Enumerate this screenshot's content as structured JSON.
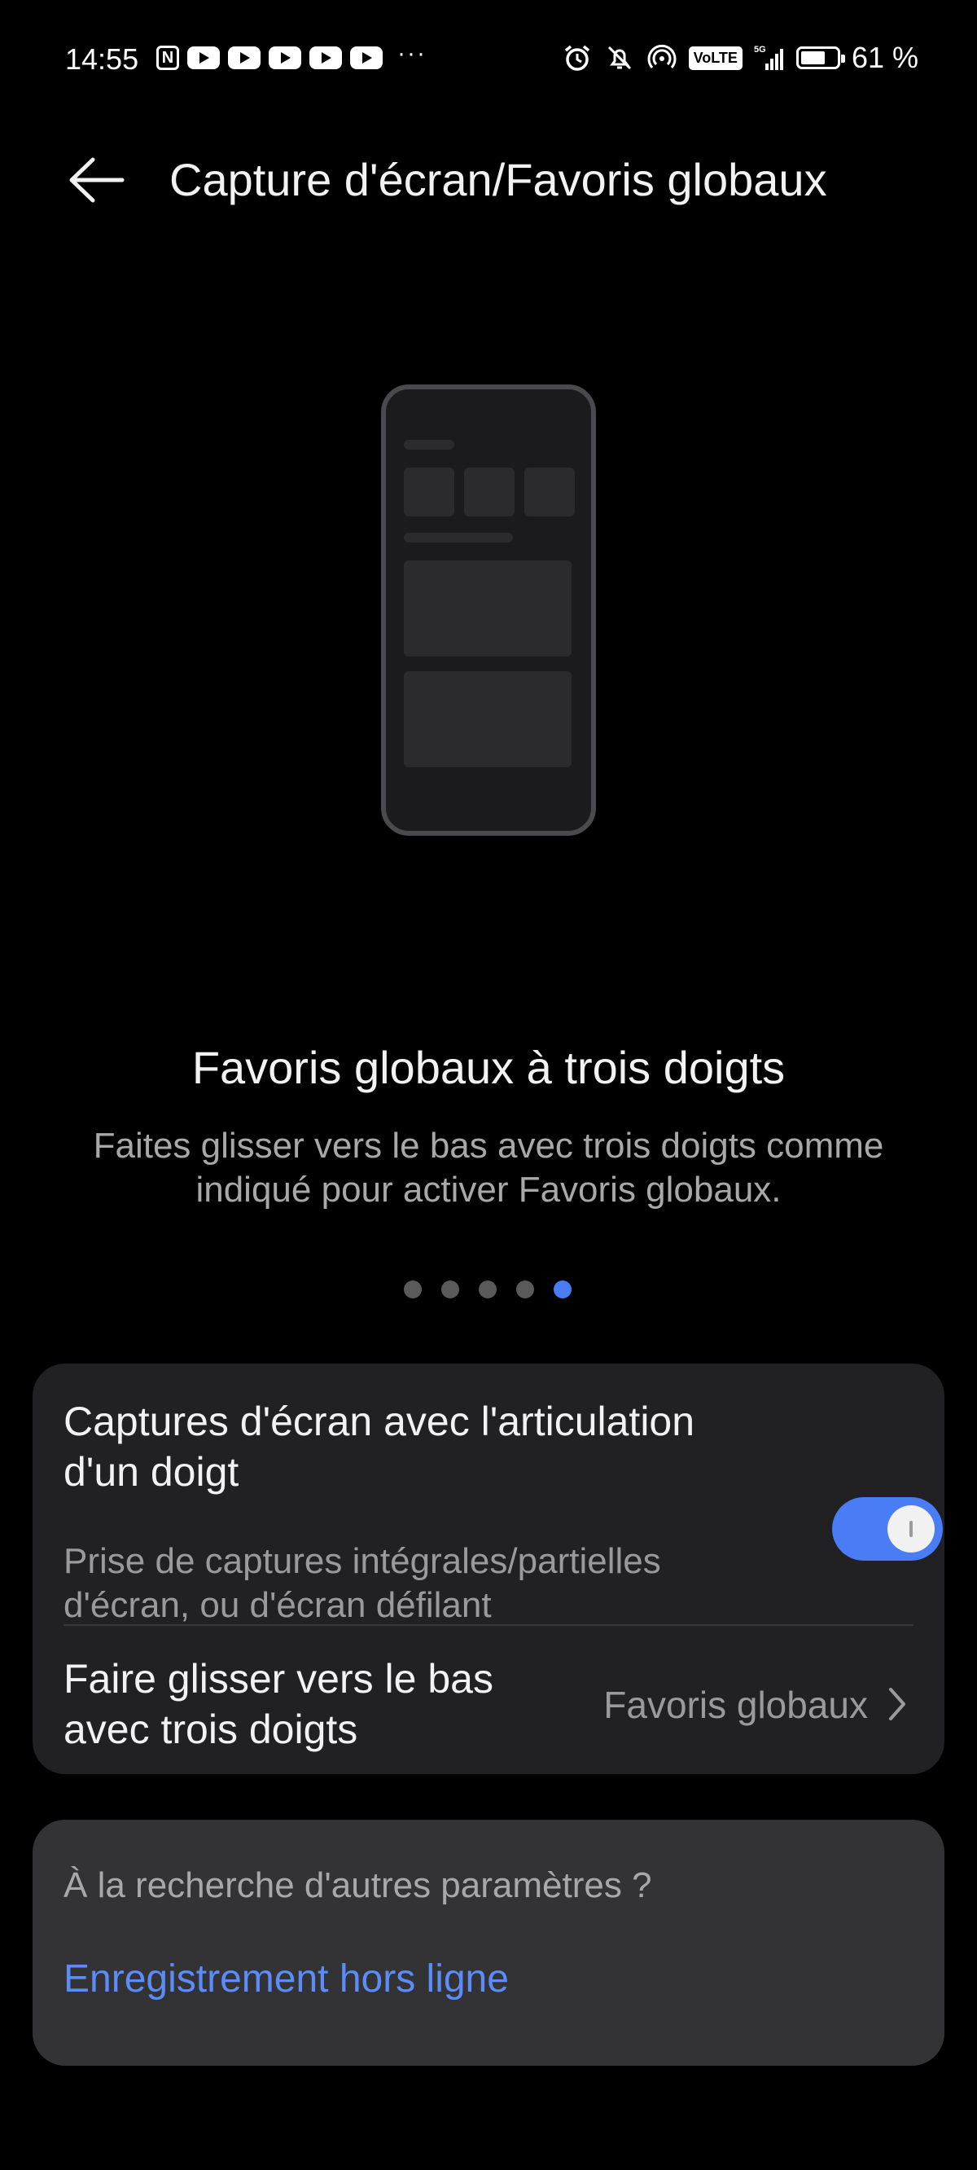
{
  "status_bar": {
    "time": "14:55",
    "left_icons": [
      "nfc-icon",
      "youtube-icon",
      "youtube-icon",
      "youtube-icon",
      "youtube-icon",
      "youtube-icon",
      "more-notifications-icon"
    ],
    "more": "···",
    "volte": "VoLTE",
    "network": "5G",
    "battery_percent": "61 %",
    "hotspot_count": "1"
  },
  "header": {
    "title": "Capture d'écran/Favoris globaux"
  },
  "feature": {
    "title": "Favoris globaux à trois doigts",
    "description": "Faites glisser vers le bas avec trois doigts comme indiqué pour activer Favoris globaux.",
    "pager_total": 5,
    "pager_active": 5
  },
  "settings": {
    "knuckle": {
      "title": "Captures d'écran avec l'articulation d'un doigt",
      "subtitle": "Prise de captures intégrales/partielles d'écran, ou d'écran défilant",
      "enabled": true
    },
    "three_finger": {
      "title": "Faire glisser vers le bas avec trois doigts",
      "value": "Favoris globaux"
    }
  },
  "suggestions": {
    "question": "À la recherche d'autres paramètres ?",
    "link": "Enregistrement hors ligne"
  },
  "colors": {
    "background": "#000000",
    "card": "#212123",
    "accent": "#4a7cf5",
    "link": "#5b8cf7"
  }
}
